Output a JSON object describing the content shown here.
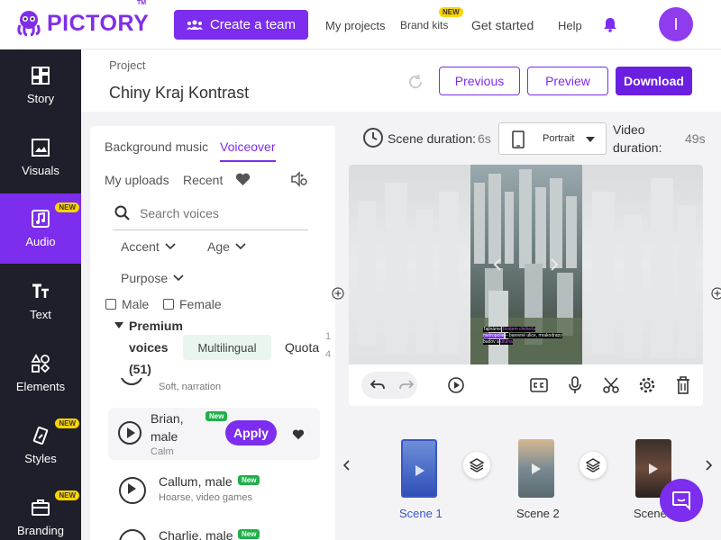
{
  "header": {
    "logo": "PICTORY",
    "tm": "TM",
    "create_team": "Create a team",
    "nav": {
      "my_projects": "My projects",
      "brand_kits": "Brand kits",
      "brand_kits_badge": "NEW",
      "get_started": "Get started",
      "help": "Help"
    },
    "avatar_initial": "I"
  },
  "sidebar": {
    "items": [
      {
        "label": "Story",
        "icon": "story-icon"
      },
      {
        "label": "Visuals",
        "icon": "image-icon"
      },
      {
        "label": "Audio",
        "icon": "music-icon",
        "badge": "NEW",
        "active": true
      },
      {
        "label": "Text",
        "icon": "text-icon"
      },
      {
        "label": "Elements",
        "icon": "shapes-icon"
      },
      {
        "label": "Styles",
        "icon": "brush-icon",
        "badge": "NEW"
      },
      {
        "label": "Branding",
        "icon": "briefcase-icon",
        "badge": "NEW"
      }
    ]
  },
  "project": {
    "label": "Project",
    "title": "Chiny Kraj Kontrast"
  },
  "actions": {
    "previous": "Previous",
    "preview": "Preview",
    "download": "Download"
  },
  "panel": {
    "tabs": [
      "Background music",
      "Voiceover"
    ],
    "subtabs": [
      "My uploads",
      "Recent"
    ],
    "search_placeholder": "Search voices",
    "filters": [
      "Accent",
      "Age",
      "Purpose"
    ],
    "gender": [
      "Male",
      "Female"
    ],
    "premium": {
      "line1": "Premium",
      "line2": "voices",
      "count": "(51)"
    },
    "chips": [
      "Multilingual",
      "Quota"
    ],
    "quota_partial": {
      "a": "1",
      "b": "4"
    },
    "cut_row_text": "Soft, narration",
    "voices": [
      {
        "name_line1": "Brian,",
        "name_line2": "male",
        "badge": "New",
        "desc": "Calm",
        "apply": "Apply"
      },
      {
        "name_line1": "Callum, male",
        "badge": "New",
        "desc": "Hoarse, video games"
      },
      {
        "name_line1": "Charlie, male",
        "badge": "New"
      }
    ]
  },
  "scene_bar": {
    "scene_duration_label": "Scene duration:",
    "scene_duration_value": "6s",
    "orientation": "Portrait",
    "video_duration_l1": "Video",
    "video_duration_l2": "duration:",
    "video_duration_value": "49s"
  },
  "captions": {
    "line1a": "Tajlnáme",
    "line1b": "životem chiňiešu",
    "line2a": "metropolie",
    "line2b": "– barevné ulice, mrakodrapy",
    "line3a": "budov a",
    "line3b": "útulna"
  },
  "scenes": [
    {
      "label": "Scene 1",
      "active": true
    },
    {
      "label": "Scene 2"
    },
    {
      "label": "Scene 3",
      "display": "Scene"
    }
  ],
  "colors": {
    "brand": "#7c2ded",
    "sidebar": "#1f1f2b",
    "badge_yellow": "#fad400",
    "badge_green": "#20b04b",
    "chip_green_bg": "#e8f6ee"
  }
}
